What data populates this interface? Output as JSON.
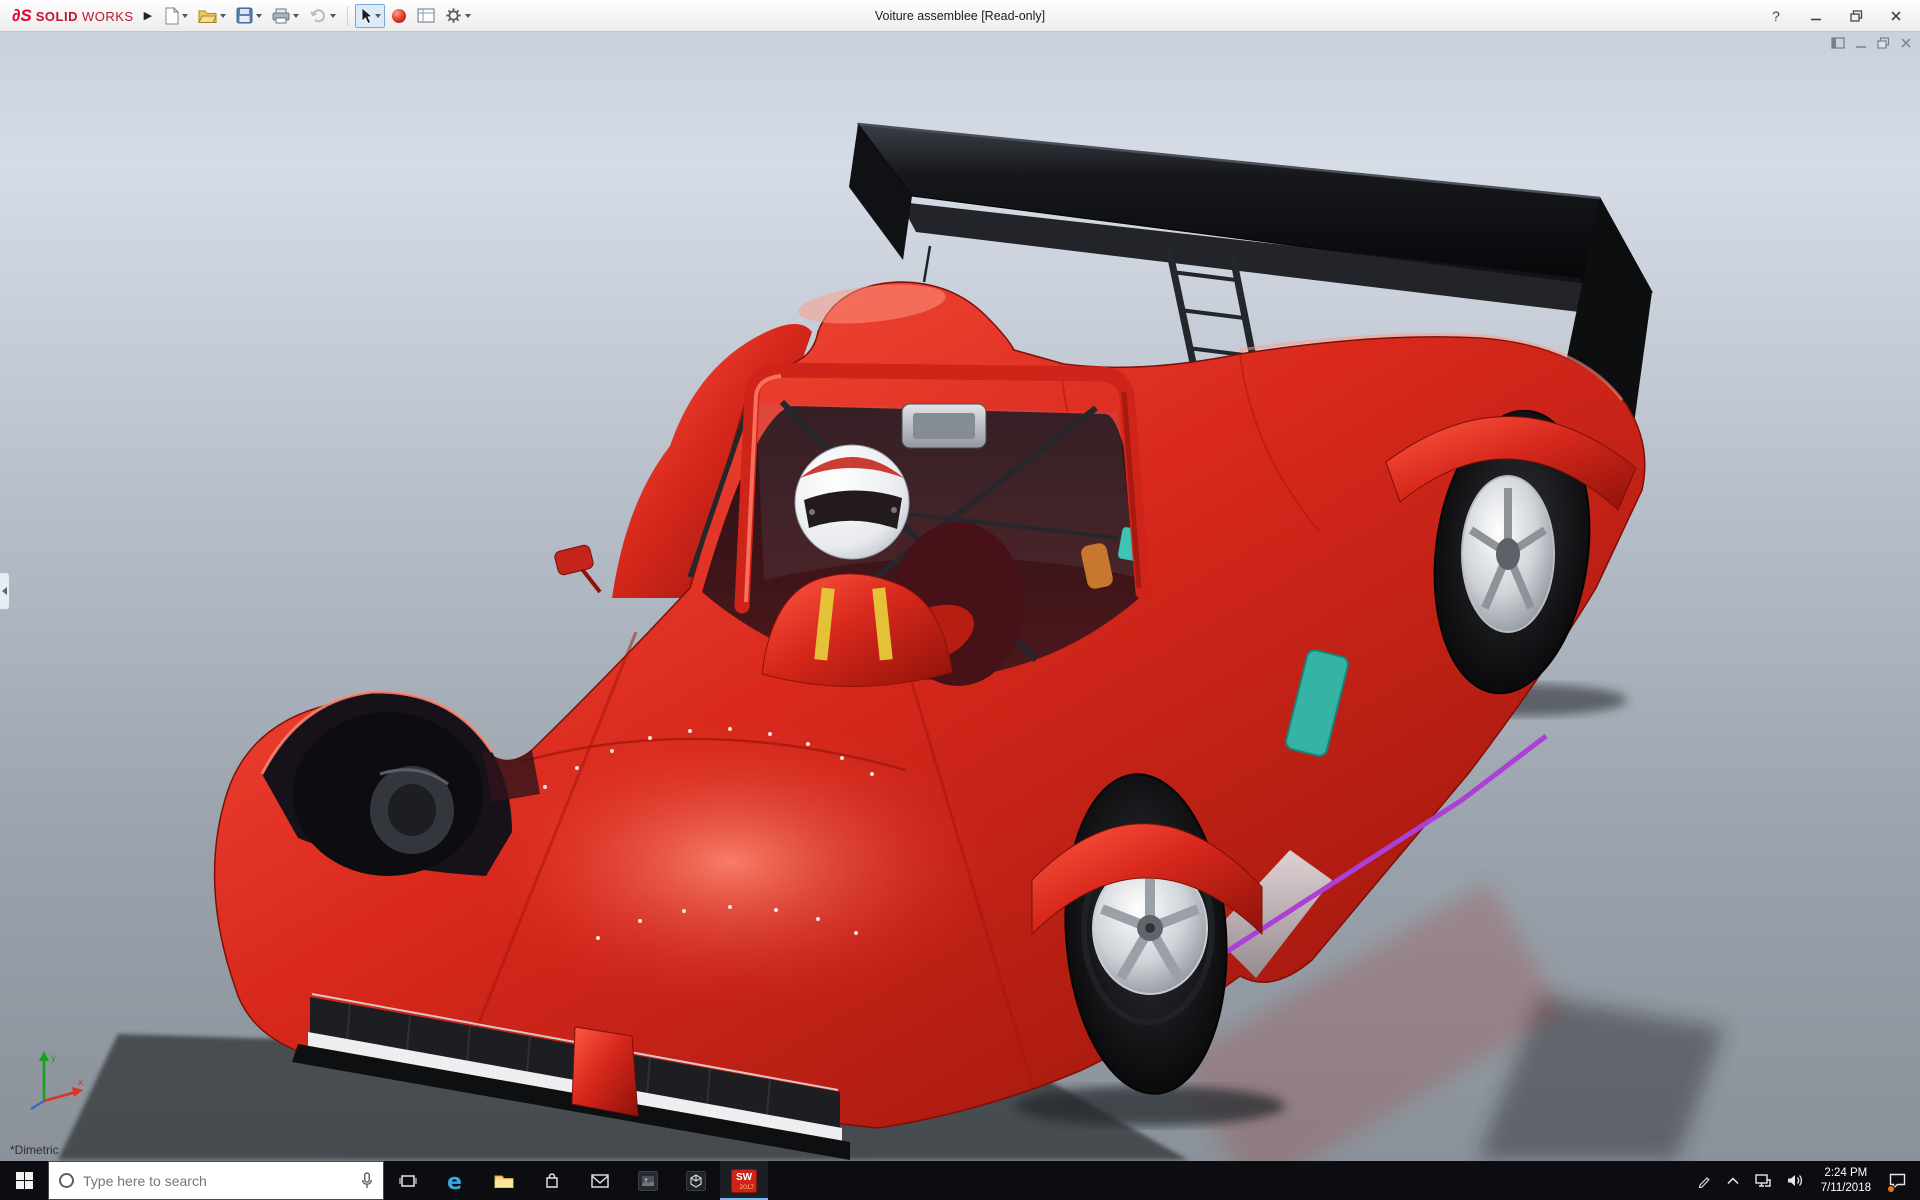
{
  "app": {
    "brand": {
      "mark": "∂S",
      "solid": "SOLID",
      "works": "WORKS",
      "flyout": "▶"
    },
    "document_title": "Voiture assemblee [Read-only]",
    "toolbar_items": [
      "new-document",
      "open",
      "save",
      "print",
      "undo",
      "select",
      "appearance",
      "drawing-sheet",
      "options"
    ],
    "window_controls": {
      "help": "?"
    }
  },
  "viewport": {
    "orientation_label": "*Dimetric",
    "triad": {
      "x_label": "x",
      "y_label": "y"
    },
    "document_controls": [
      "dock-window",
      "minimize-document",
      "restore-document",
      "close-document"
    ]
  },
  "scene": {
    "description": "red Le Mans prototype race car with helmeted driver and black rear wing, dimetric view",
    "colors": {
      "body_red": "#d3261b",
      "wing_black": "#0b0c0e",
      "accent_teal": "#35b3a4",
      "accent_purple": "#ab3fd8",
      "rim_silver": "#cfd3d8",
      "belt_yellow": "#e3c238"
    }
  },
  "taskbar": {
    "search_placeholder": "Type here to search",
    "app_icons": [
      "start",
      "task-view",
      "edge",
      "file-explorer",
      "store",
      "mail",
      "photos",
      "3d-viewer",
      "solidworks"
    ],
    "solidworks_badge": {
      "text": "SW",
      "year": "2017"
    },
    "tray_icons": [
      "pen",
      "chevron-up",
      "network",
      "volume",
      "action-center"
    ],
    "clock": {
      "time": "2:24 PM",
      "date": "7/11/2018"
    }
  }
}
